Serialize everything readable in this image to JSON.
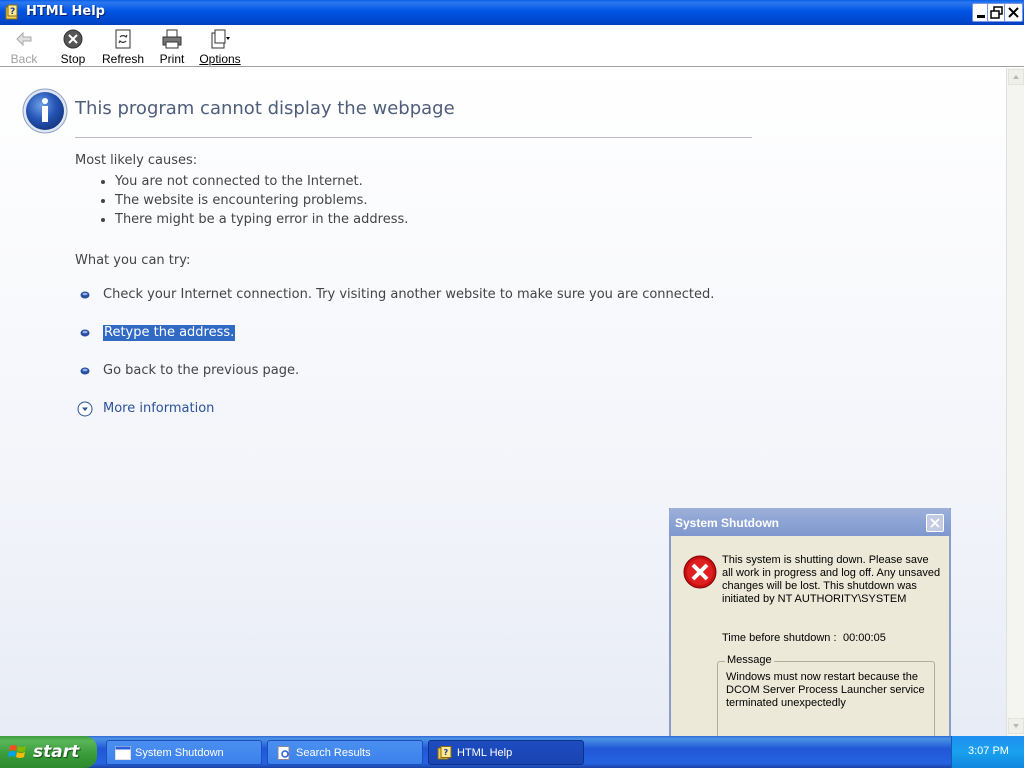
{
  "window": {
    "title": "HTML Help"
  },
  "toolbar": {
    "back": "Back",
    "stop": "Stop",
    "refresh": "Refresh",
    "print": "Print",
    "options": "Options"
  },
  "page": {
    "title": "This program cannot display the webpage",
    "causes_heading": "Most likely causes:",
    "causes": [
      "You are not connected to the Internet.",
      "The website is encountering problems.",
      "There might be a typing error in the address."
    ],
    "try_heading": "What you can try:",
    "try": [
      "Check your Internet connection. Try visiting another website to make sure you are connected.",
      "Retype the address.",
      "Go back to the previous page."
    ],
    "more_info": "More information"
  },
  "dialog": {
    "title": "System Shutdown",
    "message": "This system is shutting down. Please save all work in progress and log off. Any unsaved changes will be lost. This shutdown was initiated by NT AUTHORITY\\SYSTEM",
    "time_label": "Time before shutdown :",
    "time_value": "00:00:05",
    "group_label": "Message",
    "group_text": "Windows must now restart because the DCOM Server Process Launcher service terminated unexpectedly"
  },
  "taskbar": {
    "start": "start",
    "tasks": [
      "System Shutdown",
      "Search Results",
      "HTML Help"
    ],
    "clock": "3:07 PM"
  },
  "colors": {
    "title_bar": "#0054e3",
    "selection": "#316ac5",
    "link": "#2a5398",
    "dialog_bg": "#ece9d8"
  }
}
